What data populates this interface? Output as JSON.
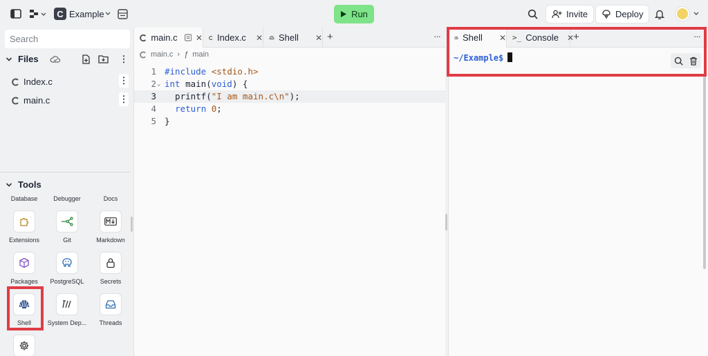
{
  "topbar": {
    "repl_name": "Example",
    "run_label": "Run",
    "invite_label": "Invite",
    "deploy_label": "Deploy"
  },
  "sidebar": {
    "search_placeholder": "Search",
    "files_header": "Files",
    "files": [
      {
        "name": "Index.c"
      },
      {
        "name": "main.c"
      }
    ],
    "tools_header": "Tools",
    "tool_top_labels": [
      "Database",
      "Debugger",
      "Docs"
    ],
    "tools": [
      {
        "label": "Extensions",
        "icon": "puzzle-icon"
      },
      {
        "label": "Git",
        "icon": "git-icon"
      },
      {
        "label": "Markdown",
        "icon": "markdown-icon"
      },
      {
        "label": "Packages",
        "icon": "package-icon"
      },
      {
        "label": "PostgreSQL",
        "icon": "postgres-icon"
      },
      {
        "label": "Secrets",
        "icon": "lock-icon"
      },
      {
        "label": "Shell",
        "icon": "shell-icon"
      },
      {
        "label": "System Dep...",
        "icon": "system-deps-icon"
      },
      {
        "label": "Threads",
        "icon": "inbox-icon"
      },
      {
        "label": "",
        "icon": "gear-icon"
      }
    ]
  },
  "editor": {
    "tabs": [
      {
        "label": "main.c",
        "active": true
      },
      {
        "label": "Index.c",
        "active": false
      },
      {
        "label": "Shell",
        "active": false
      }
    ],
    "breadcrumb": {
      "file": "main.c",
      "symbol": "main"
    },
    "lines": [
      {
        "num": "1",
        "text": "#include <stdio.h>"
      },
      {
        "num": "2",
        "text": "int main(void) {"
      },
      {
        "num": "3",
        "text": "  printf(\"I am main.c\\n\");"
      },
      {
        "num": "4",
        "text": "  return 0;"
      },
      {
        "num": "5",
        "text": "}"
      }
    ],
    "active_line": "3"
  },
  "shell": {
    "tabs": [
      {
        "label": "Shell",
        "active": true
      },
      {
        "label": "Console",
        "active": false
      }
    ],
    "prompt_path": "~/Example$"
  },
  "colors": {
    "run_green": "#7ee389",
    "highlight_red": "#e03c45",
    "keyword_blue": "#2d5fd3"
  }
}
